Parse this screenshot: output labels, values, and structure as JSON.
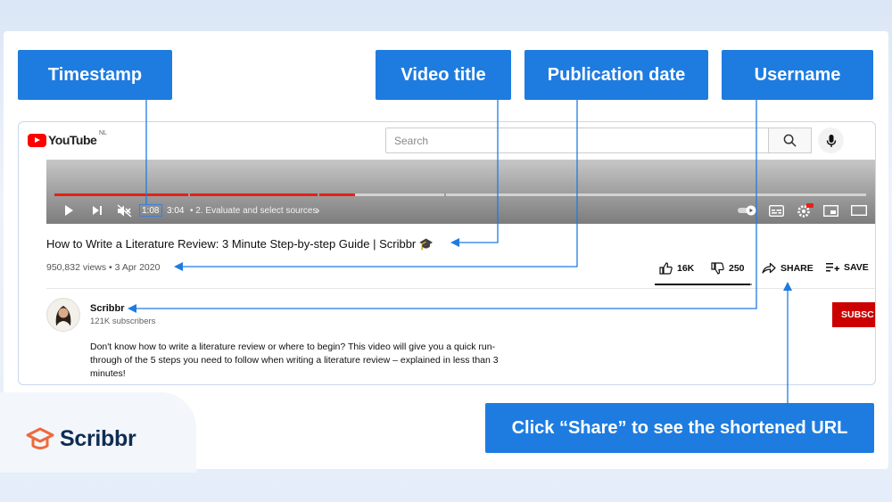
{
  "annotations": {
    "timestamp": "Timestamp",
    "video_title": "Video title",
    "publication_date": "Publication date",
    "username": "Username",
    "share_hint": "Click “Share” to see the shortened URL"
  },
  "youtube": {
    "logo_text": "YouTube",
    "region": "NL",
    "search_placeholder": "Search",
    "player": {
      "current_time": "1:08",
      "duration_text": "3:04",
      "chapter": "• 2. Evaluate and select sources",
      "chapter_chevron": "›",
      "progress": 0.37
    },
    "video": {
      "title": "How to Write a Literature Review: 3 Minute Step-by-step Guide | Scribbr 🎓",
      "views_date": "950,832 views • 3 Apr 2020",
      "likes": "16K",
      "dislikes": "250",
      "share_label": "SHARE",
      "save_label": "SAVE",
      "like_ratio": 0.98
    },
    "channel": {
      "name": "Scribbr",
      "subscribers": "121K subscribers",
      "subscribe_label": "SUBSC"
    },
    "description": "Don't know how to write a literature review or where to begin? This video will give you a quick run-through of the 5 steps you need to follow when writing a literature review – explained in less than 3 minutes!"
  },
  "brand": {
    "name": "Scribbr",
    "accent": "#1e7ce0",
    "logo_orange": "#ee6a3c",
    "youtube_red": "#ff0000"
  }
}
